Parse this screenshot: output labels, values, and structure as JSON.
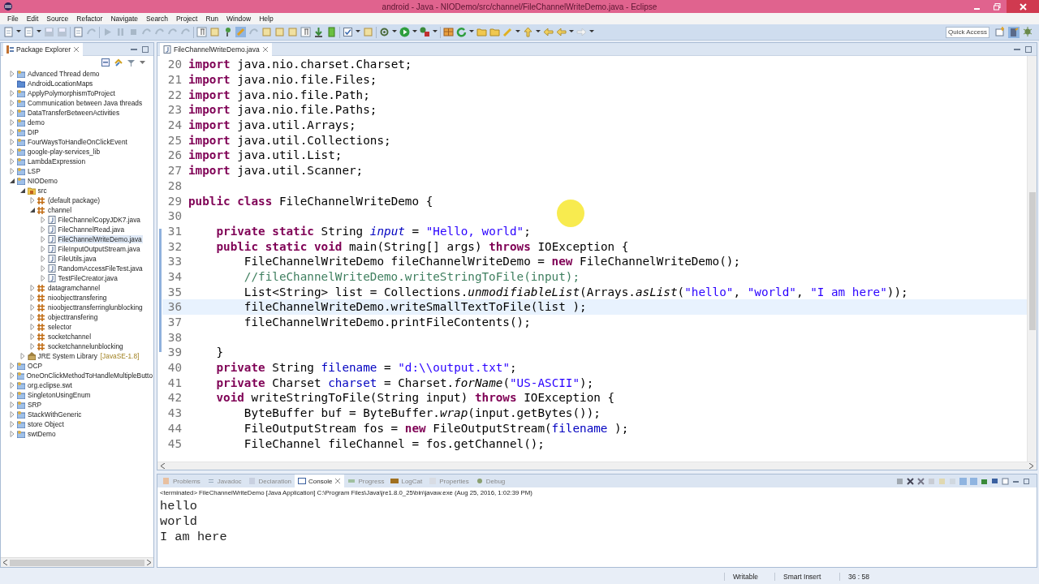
{
  "window": {
    "title": "android - Java - NIODemo/src/channel/FileChannelWriteDemo.java - Eclipse"
  },
  "menu": [
    "File",
    "Edit",
    "Source",
    "Refactor",
    "Navigate",
    "Search",
    "Project",
    "Run",
    "Window",
    "Help"
  ],
  "toolbar": {
    "quick_access": {
      "placeholder": "Quick Access"
    }
  },
  "package_explorer": {
    "title": "Package Explorer",
    "tree": [
      {
        "label": "Advanced Thread demo",
        "kind": "project",
        "expanded": false,
        "selected": false
      },
      {
        "label": "AndroidLocationMaps",
        "kind": "closed-project",
        "selected": false
      },
      {
        "label": "ApplyPolymorphismToProject",
        "kind": "project",
        "expanded": false,
        "selected": false
      },
      {
        "label": "Communication between Java threads",
        "kind": "project",
        "expanded": false,
        "selected": false
      },
      {
        "label": "DataTransferBetweenActivities",
        "kind": "project",
        "expanded": false,
        "selected": false
      },
      {
        "label": "demo",
        "kind": "project",
        "expanded": false,
        "selected": false
      },
      {
        "label": "DIP",
        "kind": "project",
        "expanded": false,
        "selected": false
      },
      {
        "label": "FourWaysToHandleOnClickEvent",
        "kind": "project",
        "expanded": false,
        "selected": false
      },
      {
        "label": "google-play-services_lib",
        "kind": "project",
        "expanded": false,
        "selected": false
      },
      {
        "label": "LambdaExpression",
        "kind": "project",
        "expanded": false,
        "selected": false
      },
      {
        "label": "LSP",
        "kind": "project",
        "expanded": false,
        "selected": false
      },
      {
        "label": "NIODemo",
        "kind": "project",
        "expanded": true,
        "selected": false,
        "children": [
          {
            "label": "src",
            "kind": "source",
            "expanded": true,
            "selected": false,
            "children": [
              {
                "label": "(default package)",
                "kind": "package",
                "expanded": false,
                "selected": false
              },
              {
                "label": "channel",
                "kind": "package",
                "expanded": true,
                "selected": false,
                "children": [
                  {
                    "label": "FileChannelCopyJDK7.java",
                    "kind": "file",
                    "expanded": false,
                    "selected": false
                  },
                  {
                    "label": "FileChannelRead.java",
                    "kind": "file",
                    "expanded": false,
                    "selected": false
                  },
                  {
                    "label": "FileChannelWriteDemo.java",
                    "kind": "file",
                    "expanded": false,
                    "selected": true
                  },
                  {
                    "label": "FileInputOutputStream.java",
                    "kind": "file",
                    "expanded": false,
                    "selected": false
                  },
                  {
                    "label": "FileUtils.java",
                    "kind": "file",
                    "expanded": false,
                    "selected": false
                  },
                  {
                    "label": "RandomAccessFileTest.java",
                    "kind": "file",
                    "expanded": false,
                    "selected": false
                  },
                  {
                    "label": "TestFileCreator.java",
                    "kind": "file",
                    "expanded": false,
                    "selected": false
                  }
                ]
              },
              {
                "label": "datagramchannel",
                "kind": "package",
                "expanded": false,
                "selected": false
              },
              {
                "label": "nioobjecttransfering",
                "kind": "package",
                "expanded": false,
                "selected": false
              },
              {
                "label": "nioobjecttransferringlunblocking",
                "kind": "package",
                "expanded": false,
                "selected": false
              },
              {
                "label": "objecttransfering",
                "kind": "package",
                "expanded": false,
                "selected": false
              },
              {
                "label": "selector",
                "kind": "package",
                "expanded": false,
                "selected": false
              },
              {
                "label": "socketchannel",
                "kind": "package",
                "expanded": false,
                "selected": false
              },
              {
                "label": "socketchannelunblocking",
                "kind": "package",
                "expanded": false,
                "selected": false
              }
            ]
          },
          {
            "label": "JRE System Library",
            "decoration": "[JavaSE-1.8]",
            "kind": "library",
            "expanded": false,
            "selected": false
          }
        ]
      },
      {
        "label": "OCP",
        "kind": "project",
        "expanded": false,
        "selected": false
      },
      {
        "label": "OneOnClickMethodToHandleMultipleButto",
        "kind": "project",
        "expanded": false,
        "selected": false
      },
      {
        "label": "org.eclipse.swt",
        "kind": "project",
        "expanded": false,
        "selected": false
      },
      {
        "label": "SingletonUsingEnum",
        "kind": "project",
        "expanded": false,
        "selected": false
      },
      {
        "label": "SRP",
        "kind": "project",
        "expanded": false,
        "selected": false
      },
      {
        "label": "StackWithGeneric",
        "kind": "project",
        "expanded": false,
        "selected": false
      },
      {
        "label": "store Object",
        "kind": "project",
        "expanded": false,
        "selected": false
      },
      {
        "label": "swtDemo",
        "kind": "project",
        "expanded": false,
        "selected": false
      }
    ]
  },
  "editor": {
    "tab": "FileChannelWriteDemo.java",
    "lines": [
      {
        "number": "20",
        "current": false,
        "tokens": [
          {
            "kind": "keyword",
            "text": "import"
          },
          {
            "kind": "plain",
            "text": " java.nio.charset.Charset;"
          }
        ]
      },
      {
        "number": "21",
        "current": false,
        "tokens": [
          {
            "kind": "keyword",
            "text": "import"
          },
          {
            "kind": "plain",
            "text": " java.nio.file.Files;"
          }
        ]
      },
      {
        "number": "22",
        "current": false,
        "tokens": [
          {
            "kind": "keyword",
            "text": "import"
          },
          {
            "kind": "plain",
            "text": " java.nio.file.Path;"
          }
        ]
      },
      {
        "number": "23",
        "current": false,
        "tokens": [
          {
            "kind": "keyword",
            "text": "import"
          },
          {
            "kind": "plain",
            "text": " java.nio.file.Paths;"
          }
        ]
      },
      {
        "number": "24",
        "current": false,
        "tokens": [
          {
            "kind": "keyword",
            "text": "import"
          },
          {
            "kind": "plain",
            "text": " java.util.Arrays;"
          }
        ]
      },
      {
        "number": "25",
        "current": false,
        "tokens": [
          {
            "kind": "keyword",
            "text": "import"
          },
          {
            "kind": "plain",
            "text": " java.util.Collections;"
          }
        ]
      },
      {
        "number": "26",
        "current": false,
        "tokens": [
          {
            "kind": "keyword",
            "text": "import"
          },
          {
            "kind": "plain",
            "text": " java.util.List;"
          }
        ]
      },
      {
        "number": "27",
        "current": false,
        "tokens": [
          {
            "kind": "keyword",
            "text": "import"
          },
          {
            "kind": "plain",
            "text": " java.util.Scanner;"
          }
        ]
      },
      {
        "number": "28",
        "current": false
      },
      {
        "number": "29",
        "current": false,
        "tokens": [
          {
            "kind": "keyword",
            "text": "public"
          },
          {
            "kind": "keyword",
            "text": " class"
          },
          {
            "kind": "plain",
            "text": " FileChannelWriteDemo {"
          }
        ]
      },
      {
        "number": "30",
        "current": false
      },
      {
        "number": "31",
        "current": false,
        "tokens": [
          {
            "kind": "keyword",
            "text": "    private"
          },
          {
            "kind": "keyword",
            "text": " static"
          },
          {
            "kind": "plain",
            "text": " String "
          },
          {
            "kind": "static_field",
            "text": "input"
          },
          {
            "kind": "plain",
            "text": " = "
          },
          {
            "kind": "string",
            "text": "\"Hello, world\""
          },
          {
            "kind": "plain",
            "text": ";"
          }
        ]
      },
      {
        "number": "32",
        "current": false,
        "tokens": [
          {
            "kind": "keyword",
            "text": "    public"
          },
          {
            "kind": "keyword",
            "text": " static"
          },
          {
            "kind": "keyword",
            "text": " void"
          },
          {
            "kind": "plain",
            "text": " main(String[] args) "
          },
          {
            "kind": "keyword",
            "text": "throws"
          },
          {
            "kind": "plain",
            "text": " IOException {"
          }
        ]
      },
      {
        "number": "33",
        "current": false,
        "tokens": [
          {
            "kind": "plain",
            "text": "        FileChannelWriteDemo fileChannelWriteDemo = "
          },
          {
            "kind": "keyword",
            "text": "new"
          },
          {
            "kind": "plain",
            "text": " FileChannelWriteDemo();"
          }
        ]
      },
      {
        "number": "34",
        "current": false,
        "tokens": [
          {
            "kind": "comment",
            "text": "        //fileChannelWriteDemo.writeStringToFile(input);"
          }
        ]
      },
      {
        "number": "35",
        "current": false,
        "tokens": [
          {
            "kind": "plain",
            "text": "        List<String> list = Collections."
          },
          {
            "kind": "static_method",
            "text": "unmodifiableList"
          },
          {
            "kind": "plain",
            "text": "(Arrays."
          },
          {
            "kind": "static_method",
            "text": "asList"
          },
          {
            "kind": "plain",
            "text": "("
          },
          {
            "kind": "string",
            "text": "\"hello\""
          },
          {
            "kind": "plain",
            "text": ", "
          },
          {
            "kind": "string",
            "text": "\"world\""
          },
          {
            "kind": "plain",
            "text": ", "
          },
          {
            "kind": "string",
            "text": "\"I am here\""
          },
          {
            "kind": "plain",
            "text": "));"
          }
        ]
      },
      {
        "number": "36",
        "current": true,
        "tokens": [
          {
            "kind": "plain",
            "text": "        fileChannelWriteDemo.writeSmallTextToFile(list );"
          }
        ]
      },
      {
        "number": "37",
        "current": false,
        "tokens": [
          {
            "kind": "plain",
            "text": "        fileChannelWriteDemo.printFileContents();"
          }
        ]
      },
      {
        "number": "38",
        "current": false
      },
      {
        "number": "39",
        "current": false,
        "tokens": [
          {
            "kind": "plain",
            "text": "    }"
          }
        ]
      },
      {
        "number": "40",
        "current": false,
        "tokens": [
          {
            "kind": "keyword",
            "text": "    private"
          },
          {
            "kind": "plain",
            "text": " String "
          },
          {
            "kind": "field",
            "text": "filename"
          },
          {
            "kind": "plain",
            "text": " = "
          },
          {
            "kind": "string",
            "text": "\"d:\\\\output.txt\""
          },
          {
            "kind": "plain",
            "text": ";"
          }
        ]
      },
      {
        "number": "41",
        "current": false,
        "tokens": [
          {
            "kind": "keyword",
            "text": "    private"
          },
          {
            "kind": "plain",
            "text": " Charset "
          },
          {
            "kind": "field",
            "text": "charset"
          },
          {
            "kind": "plain",
            "text": " = Charset."
          },
          {
            "kind": "static_method",
            "text": "forName"
          },
          {
            "kind": "plain",
            "text": "("
          },
          {
            "kind": "string",
            "text": "\"US-ASCII\""
          },
          {
            "kind": "plain",
            "text": ");"
          }
        ]
      },
      {
        "number": "42",
        "current": false,
        "tokens": [
          {
            "kind": "keyword",
            "text": "    void"
          },
          {
            "kind": "plain",
            "text": " writeStringToFile(String input) "
          },
          {
            "kind": "keyword",
            "text": "throws"
          },
          {
            "kind": "plain",
            "text": " IOException {"
          }
        ]
      },
      {
        "number": "43",
        "current": false,
        "tokens": [
          {
            "kind": "plain",
            "text": "        ByteBuffer buf = ByteBuffer."
          },
          {
            "kind": "static_method",
            "text": "wrap"
          },
          {
            "kind": "plain",
            "text": "(input.getBytes());"
          }
        ]
      },
      {
        "number": "44",
        "current": false,
        "tokens": [
          {
            "kind": "plain",
            "text": "        FileOutputStream fos = "
          },
          {
            "kind": "keyword",
            "text": "new"
          },
          {
            "kind": "plain",
            "text": " FileOutputStream("
          },
          {
            "kind": "field",
            "text": "filename"
          },
          {
            "kind": "plain",
            "text": " );"
          }
        ]
      },
      {
        "number": "45",
        "current": false,
        "tokens": [
          {
            "kind": "plain",
            "text": "        FileChannel fileChannel = fos.getChannel();"
          }
        ]
      }
    ]
  },
  "bottom_panel": {
    "tabs": [
      {
        "label": "Problems",
        "selected": false
      },
      {
        "label": "Javadoc",
        "selected": false
      },
      {
        "label": "Declaration",
        "selected": false
      },
      {
        "label": "Console",
        "selected": true
      },
      {
        "label": "Progress",
        "selected": false
      },
      {
        "label": "LogCat",
        "selected": false
      },
      {
        "label": "Properties",
        "selected": false
      },
      {
        "label": "Debug",
        "selected": false
      }
    ],
    "console": {
      "header": "<terminated> FileChannelWriteDemo [Java Application] C:\\Program Files\\Java\\jre1.8.0_25\\bin\\javaw.exe (Aug 25, 2016, 1:02:39 PM)",
      "output": [
        "hello",
        "world",
        "I am here"
      ]
    }
  },
  "status_bar": {
    "items": [
      "Writable",
      "Smart Insert",
      "36 : 58"
    ]
  }
}
